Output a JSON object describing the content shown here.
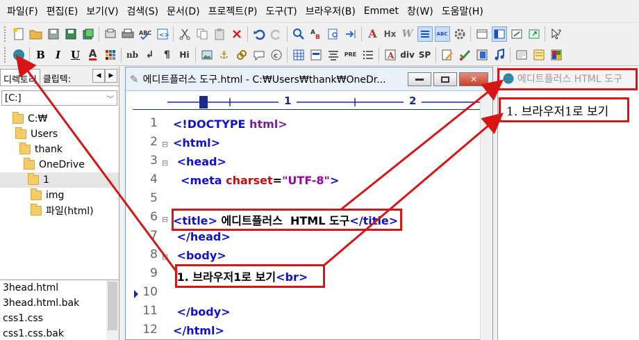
{
  "menu": [
    "파일(F)",
    "편집(E)",
    "보기(V)",
    "검색(S)",
    "문서(D)",
    "프로젝트(P)",
    "도구(T)",
    "브라우저(B)",
    "Emmet",
    "창(W)",
    "도움말(H)"
  ],
  "toolbar2_text": [
    "B",
    "I",
    "U",
    "A",
    "nb",
    "↲",
    "¶",
    "Hi",
    "⚓",
    "PRE",
    "div",
    "SP"
  ],
  "toolbar1_text": [
    "A",
    "Hx",
    "W",
    "ABC"
  ],
  "left_panel": {
    "tab_directory": "디렉토리",
    "tab_clip": "클립텍:",
    "drive": "[C:]",
    "tree": [
      "C:₩",
      "Users",
      "thank",
      "OneDrive",
      "1",
      "img",
      "파일(html)"
    ],
    "files": [
      "3head.html",
      "3head.html.bak",
      "css1.css",
      "css1.css.bak"
    ]
  },
  "editor": {
    "title": "에디트플러스 도구.html - C:₩Users₩thank₩OneDr...",
    "ruler_label_1": "1",
    "ruler_label_2": "2",
    "line_numbers": [
      "1",
      "2",
      "3",
      "4",
      "5",
      "6",
      "7",
      "8",
      "9",
      "10",
      "11",
      "12"
    ],
    "lines": {
      "l1_doc": "<!DOCTYPE",
      "l1_html": " html>",
      "l2": "<html>",
      "l3": " <head>",
      "l4_open": "  <meta",
      "l4_attr": " charset",
      "l4_eq": "=",
      "l4_val": "\"UTF-8\"",
      "l4_close": ">",
      "l6_open": "<title>",
      "l6_text": " 에디트플러스  HTML 도구",
      "l6_close": "</title>",
      "l7": " </head>",
      "l8": " <body>",
      "l9_text": " 1. 브라우저1로 보기",
      "l9_tag": "<br>",
      "l11": " </body>",
      "l12": "</html>"
    }
  },
  "browser": {
    "title": "에디트플러스 HTML 도구",
    "content": "1. 브라우저1로 보기"
  },
  "colors": {
    "tag": "#1010d0",
    "attr": "#c01010",
    "string": "#a000a0",
    "annotation": "#d81515"
  }
}
